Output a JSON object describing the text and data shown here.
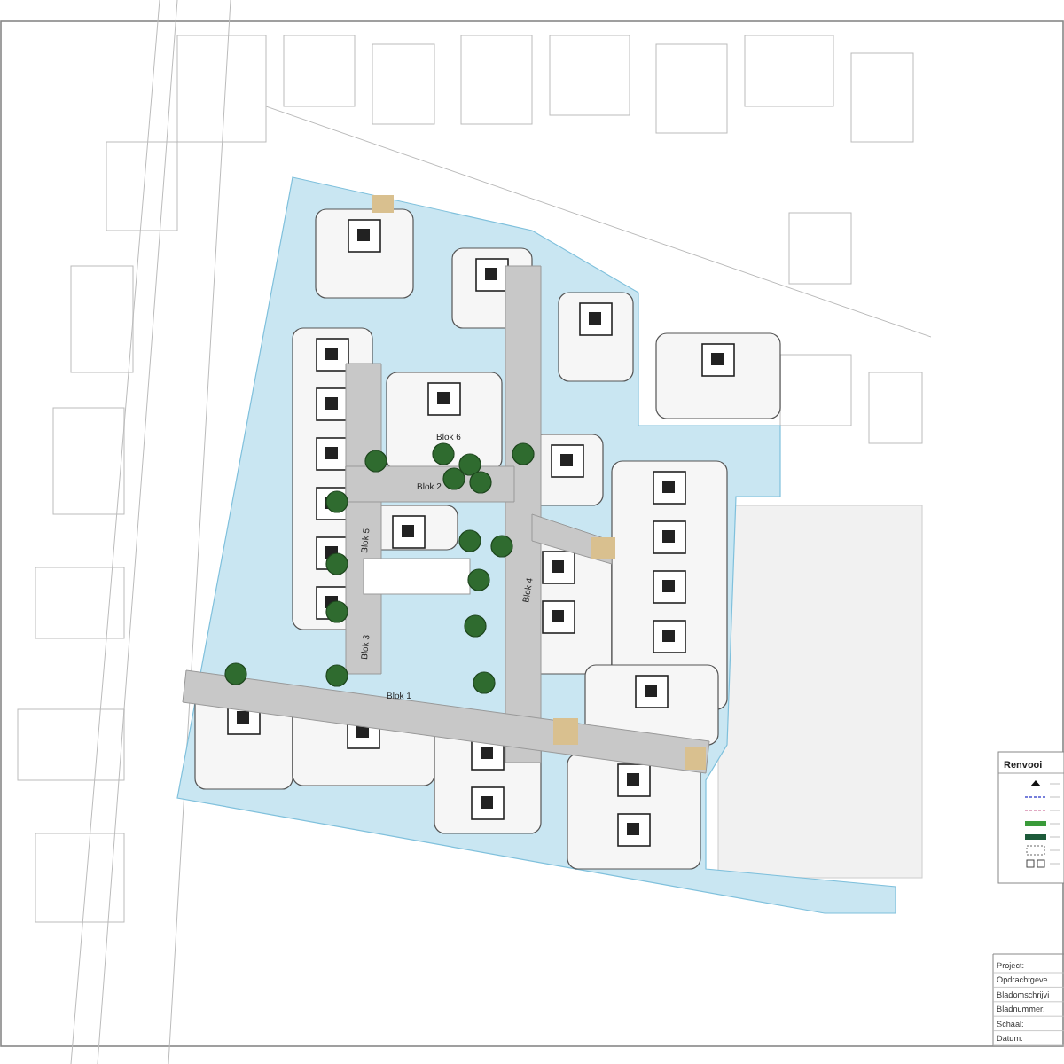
{
  "site_plan": {
    "blocks": [
      {
        "label": "Blok 1"
      },
      {
        "label": "Blok 2"
      },
      {
        "label": "Blok 3"
      },
      {
        "label": "Blok 4"
      },
      {
        "label": "Blok 5"
      },
      {
        "label": "Blok 6"
      }
    ]
  },
  "legend": {
    "title": "Renvooi",
    "items": [
      {
        "kind": "triangle"
      },
      {
        "kind": "dashed-blue"
      },
      {
        "kind": "dashed-pink"
      },
      {
        "kind": "bar-light"
      },
      {
        "kind": "bar-dark"
      },
      {
        "kind": "dotted-box"
      },
      {
        "kind": "squares"
      }
    ]
  },
  "title_block": {
    "fields": [
      {
        "label": "Project:"
      },
      {
        "label": "Opdrachtgeve"
      },
      {
        "label": "Bladomschrijvi"
      },
      {
        "label": "Bladnummer:"
      },
      {
        "label": "Schaal:"
      },
      {
        "label": "Datum:"
      }
    ]
  }
}
